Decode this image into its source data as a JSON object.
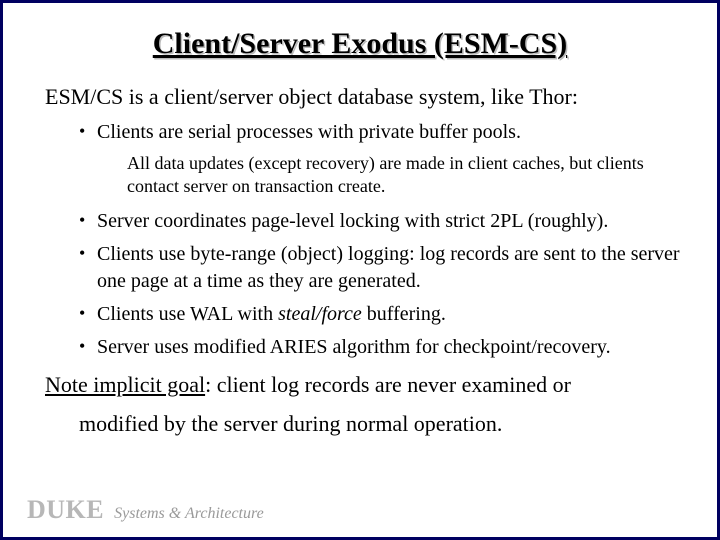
{
  "title": "Client/Server Exodus (ESM-CS)",
  "intro": "ESM/CS is a client/server object database system, like Thor:",
  "bullets": {
    "b1": "Clients are serial processes with private buffer pools.",
    "sub1": "All data updates (except recovery) are made in client caches, but clients contact server on transaction create.",
    "b2": "Server coordinates page-level locking with strict 2PL (roughly).",
    "b3": "Clients use byte-range (object) logging: log records are sent to the server one page at a time as they are generated.",
    "b4_pre": "Clients use WAL with ",
    "b4_em": "steal/force",
    "b4_post": " buffering.",
    "b5": "Server uses modified ARIES algorithm for checkpoint/recovery."
  },
  "closing": {
    "lead": "Note implicit goal",
    "rest1": ": client log records are never examined or",
    "rest2": "modified by the server during normal operation."
  },
  "footer": {
    "org": "DUKE",
    "group": "Systems & Architecture"
  }
}
